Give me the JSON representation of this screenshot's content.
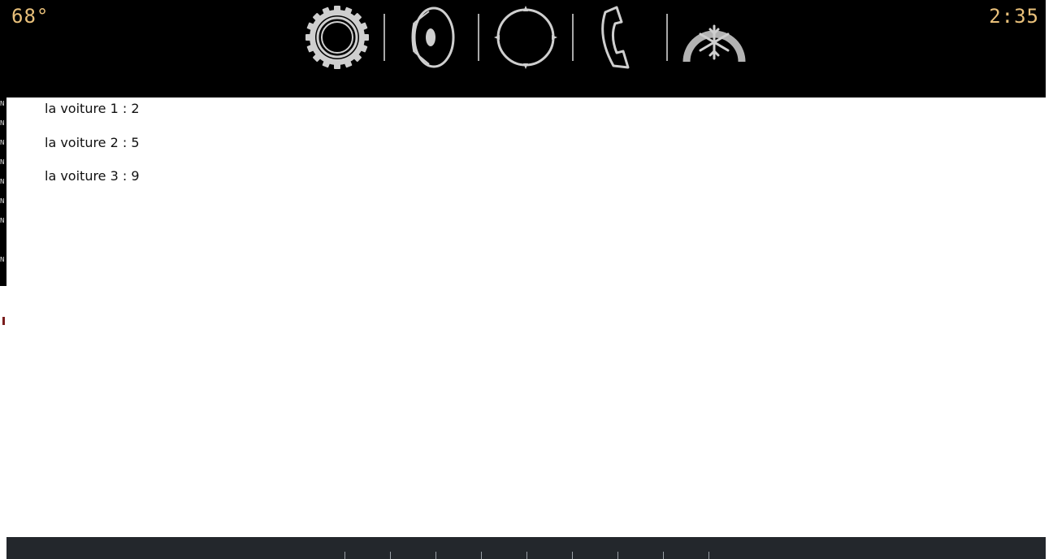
{
  "header": {
    "temperature": "68°",
    "time": "2:35",
    "text_color": "#e9c07a",
    "background": "#000000",
    "icons": [
      {
        "name": "settings-gear-icon"
      },
      {
        "name": "speaker-icon"
      },
      {
        "name": "compass-icon"
      },
      {
        "name": "phone-icon"
      },
      {
        "name": "climate-snowflake-icon"
      }
    ]
  },
  "main": {
    "items": [
      {
        "text": "la voiture 1 : 2"
      },
      {
        "text": "la voiture 2 : 5"
      },
      {
        "text": "la voiture 3 : 9"
      }
    ]
  },
  "left_terminal": {
    "chars": [
      "N",
      "N",
      "N",
      "N",
      "N",
      "N",
      "N",
      "N",
      "N"
    ]
  },
  "footer": {
    "background": "#23272c"
  }
}
